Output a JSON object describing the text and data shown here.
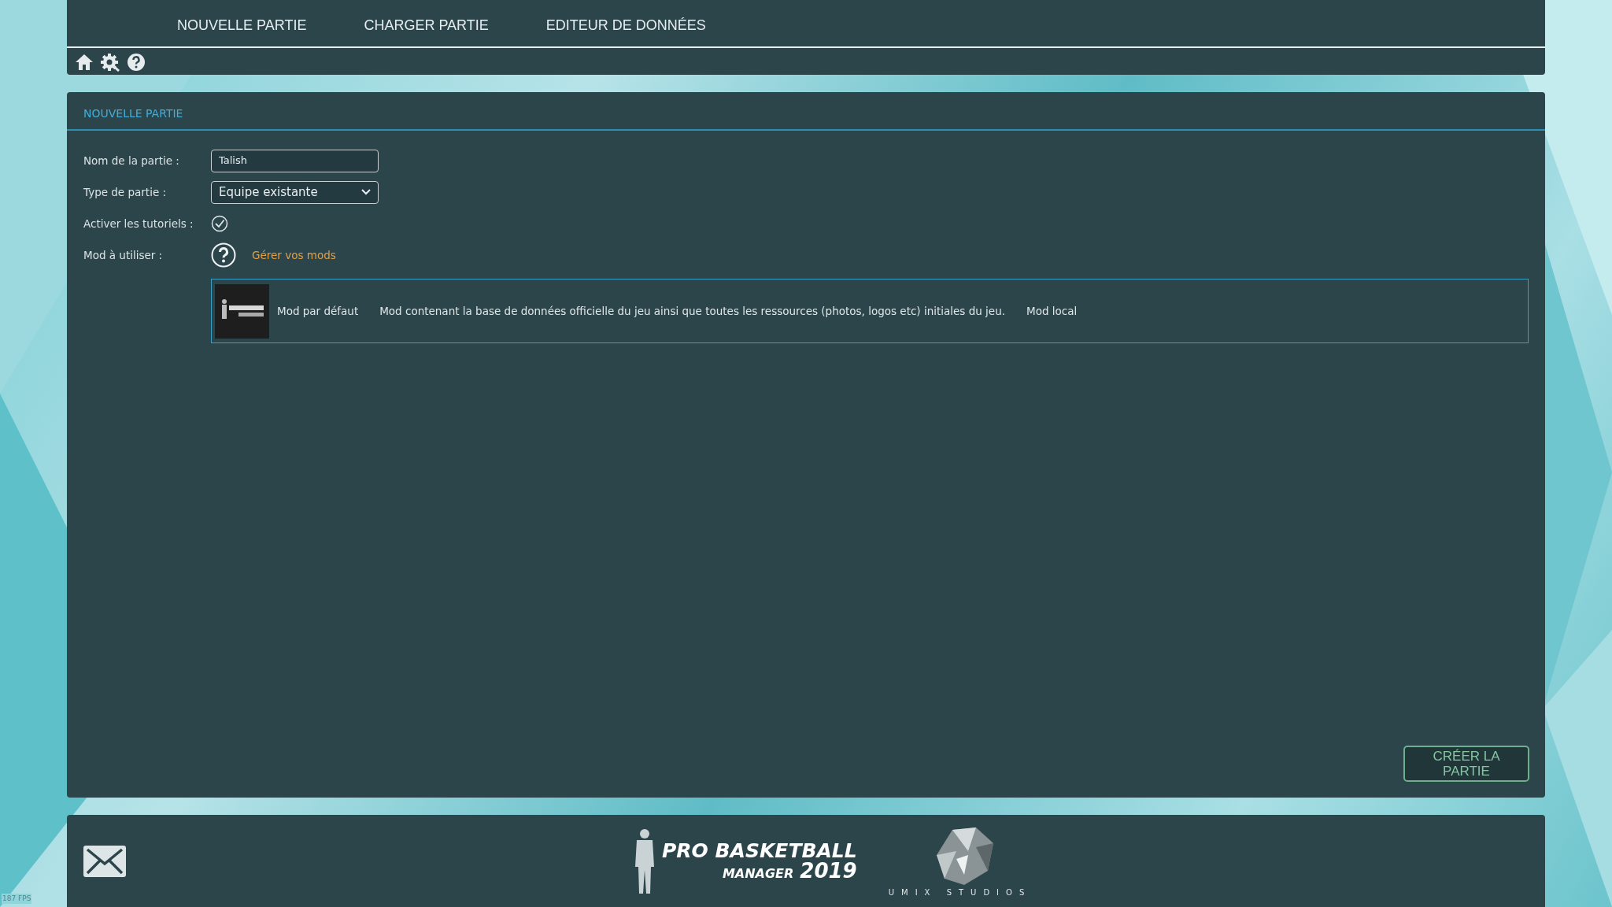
{
  "top_nav": {
    "tabs": [
      {
        "label": "NOUVELLE PARTIE",
        "selected": false
      },
      {
        "label": "CHARGER PARTIE",
        "selected": false
      },
      {
        "label": "EDITEUR DE DONNÉES",
        "selected": false
      }
    ]
  },
  "panel": {
    "title": "NOUVELLE PARTIE",
    "name_field": {
      "label": "Nom de la partie :",
      "value": "Talish"
    },
    "type_field": {
      "label": "Type de partie :",
      "value": "Equipe existante"
    },
    "tutorials": {
      "label": "Activer les tutoriels :",
      "checked": true
    },
    "mod": {
      "label": "Mod à utiliser :",
      "link": "Gérer vos mods"
    },
    "mods": [
      {
        "name": "Mod par défaut",
        "description": "Mod contenant la base de données officielle du jeu ainsi que toutes les ressources (photos, logos etc) initiales du jeu.",
        "source": "Mod local",
        "selected": true
      }
    ],
    "create_button": "CRÉER LA PARTIE"
  },
  "footer": {
    "game_logo": {
      "line1": "PRO BASKETBALL",
      "line2": "MANAGER",
      "year": "2019"
    },
    "studio_logo": "UMIX STUDIOS"
  },
  "fps": "187 FPS"
}
